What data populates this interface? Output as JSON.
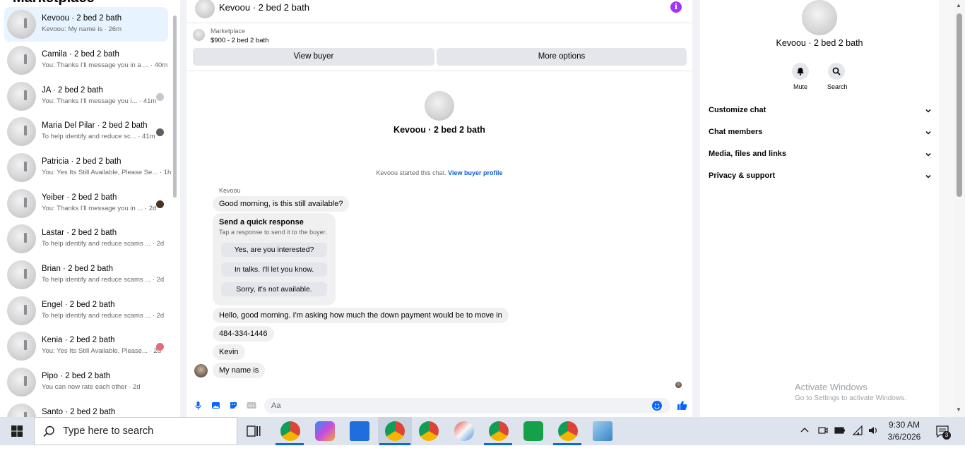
{
  "left": {
    "title": "Marketplace",
    "conversations": [
      {
        "name": "Kevoou · 2 bed 2 bath",
        "snippet": "Kevoou: My name is · 26m",
        "active": true
      },
      {
        "name": "Camila · 2 bed 2 bath",
        "snippet": "You: Thanks I'll message you in a ... · 40m"
      },
      {
        "name": "JA · 2 bed 2 bath",
        "snippet": "You: Thanks I'll message you i... · 41m"
      },
      {
        "name": "Maria Del Pilar · 2 bed 2 bath",
        "snippet": "To help identify and reduce sc... · 41m"
      },
      {
        "name": "Patricia · 2 bed 2 bath",
        "snippet": "You: Yes Its Still Available, Please Se... · 1h"
      },
      {
        "name": "Yeiber · 2 bed 2 bath",
        "snippet": "You: Thanks I'll message you in ... · 2d"
      },
      {
        "name": "Lastar · 2 bed 2 bath",
        "snippet": "To help identify and reduce scams ... · 2d"
      },
      {
        "name": "Brian · 2 bed 2 bath",
        "snippet": "To help identify and reduce scams ... · 2d"
      },
      {
        "name": "Engel · 2 bed 2 bath",
        "snippet": "To help identify and reduce scams ... · 2d"
      },
      {
        "name": "Kenia · 2 bed 2 bath",
        "snippet": "You: Yes Its Still Available, Please... · 2d"
      },
      {
        "name": "Pipo · 2 bed 2 bath",
        "snippet": "You can now rate each other · 2d"
      },
      {
        "name": "Santo · 2 bed 2 bath",
        "snippet": ""
      }
    ]
  },
  "chat": {
    "header_title": "Kevoou · 2 bed 2 bath",
    "info_icon": "i",
    "marketplace_label": "Marketplace",
    "listing": "$900 - 2 bed 2 bath",
    "view_buyer": "View buyer",
    "more_options": "More options",
    "profile_name": "Kevoou · 2 bed 2 bath",
    "started_text": "Kevoou started this chat.",
    "view_profile_link": "View buyer profile",
    "sender": "Kevoou",
    "msg1": "Good morning, is this still available?",
    "quick_title": "Send a quick response",
    "quick_sub": "Tap a response to send it to the buyer.",
    "quick_options": [
      "Yes, are you interested?",
      "In talks. I'll let you know.",
      "Sorry, it's not available."
    ],
    "msg2": "Hello, good morning. I'm asking how much the down payment would be to move in",
    "msg3": "484-334-1446",
    "msg4": "Kevin",
    "msg5": "My name is",
    "composer_placeholder": "Aa"
  },
  "right": {
    "name": "Kevoou · 2 bed 2 bath",
    "mute": "Mute",
    "search": "Search",
    "sections": [
      "Customize chat",
      "Chat members",
      "Media, files and links",
      "Privacy & support"
    ]
  },
  "watermark": {
    "line1": "Activate Windows",
    "line2": "Go to Settings to activate Windows."
  },
  "taskbar": {
    "search_placeholder": "Type here to search",
    "time": "9:30 AM",
    "date": "3/6/2026",
    "notifications": "3"
  },
  "colors": {
    "accent": "#0866ff",
    "info": "#a033ff",
    "active_row": "#e7f3ff",
    "link": "#0a5ed7"
  }
}
